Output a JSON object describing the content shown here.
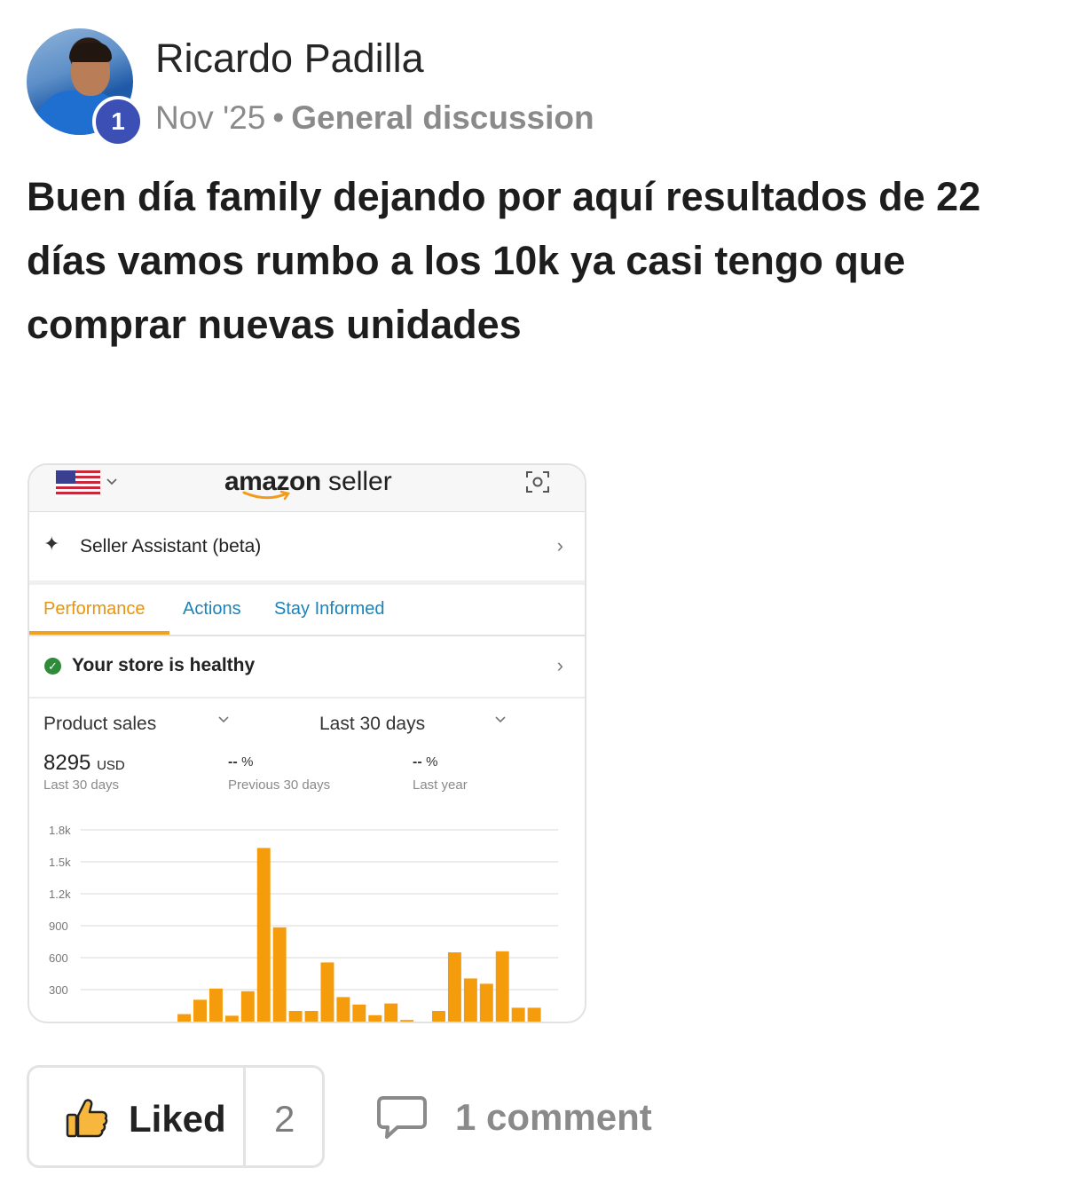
{
  "post": {
    "author": "Ricardo Padilla",
    "level_badge": "1",
    "date": "Nov '25",
    "separator": "•",
    "category": "General discussion",
    "body": "Buen día family dejando por aquí resultados de 22 días vamos rumbo a los 10k ya casi tengo que comprar nuevas unidades"
  },
  "screenshot": {
    "logo_bold": "amazon",
    "logo_light": " seller",
    "assistant_label": "Seller Assistant (beta)",
    "tabs": [
      {
        "label": "Performance",
        "active": true
      },
      {
        "label": "Actions",
        "active": false
      },
      {
        "label": "Stay Informed",
        "active": false
      }
    ],
    "health_label": "Your store is healthy",
    "metric_select": "Product sales",
    "period_select": "Last 30 days",
    "stats": {
      "value": "8295",
      "unit": "USD",
      "value_caption": "Last 30 days",
      "prev_dash": "--",
      "prev_pct": "%",
      "prev_caption": "Previous 30 days",
      "year_dash": "--",
      "year_pct": "%",
      "year_caption": "Last year"
    },
    "icons": {
      "flag": "us-flag-icon",
      "scan": "scan-icon",
      "spark": "sparkle-icon",
      "check": "check-circle-icon"
    },
    "colors": {
      "bar": "#f59c0c",
      "active_tab": "#e8940f",
      "tab": "#1a84b8",
      "healthy": "#2e8b3a"
    }
  },
  "chart_data": {
    "type": "bar",
    "title": "",
    "xlabel": "",
    "ylabel": "",
    "ylim": [
      0,
      1800
    ],
    "yticks": [
      "1.8k",
      "1.5k",
      "1.2k",
      "900",
      "600",
      "300"
    ],
    "ytick_values": [
      1800,
      1500,
      1200,
      900,
      600,
      300
    ],
    "grid": true,
    "series": [
      {
        "values": [
          0,
          0,
          0,
          0,
          0,
          0,
          70,
          205,
          310,
          55,
          285,
          1630,
          885,
          100,
          100,
          555,
          230,
          160,
          60,
          170,
          15,
          0,
          100,
          650,
          405,
          355,
          660,
          130,
          130,
          0
        ]
      }
    ]
  },
  "actions": {
    "like_label": "Liked",
    "like_count": "2",
    "comment_label": "1 comment"
  }
}
